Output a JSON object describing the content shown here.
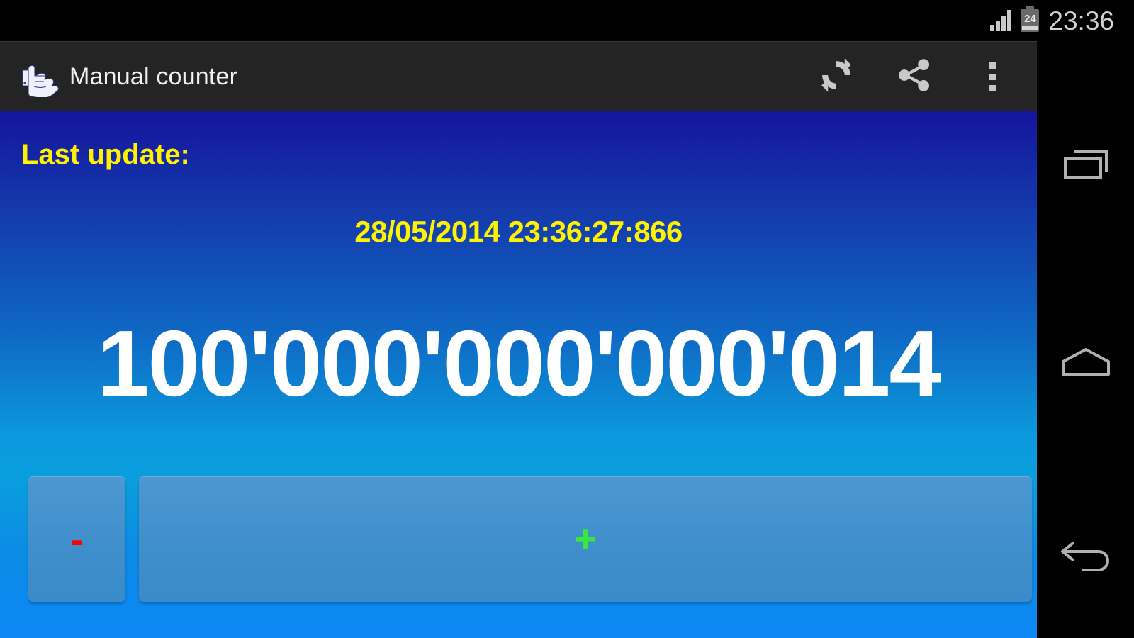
{
  "status_bar": {
    "clock": "23:36",
    "battery_level": "24",
    "signal_icon": "signal-bars-icon",
    "battery_icon": "battery-icon"
  },
  "action_bar": {
    "app_icon": "hand-counting-icon",
    "title": "Manual counter",
    "actions": [
      {
        "name": "refresh-action",
        "icon": "refresh-icon"
      },
      {
        "name": "share-action",
        "icon": "share-icon"
      },
      {
        "name": "overflow-action",
        "icon": "overflow-menu-icon"
      }
    ]
  },
  "main": {
    "last_update_label": "Last update:",
    "last_update_value": "28/05/2014 23:36:27:866",
    "counter_value": "100'000'000'000'014",
    "decrement_label": "-",
    "increment_label": "+"
  },
  "nav_bar": {
    "recents_icon": "recents-icon",
    "home_icon": "home-icon",
    "back_icon": "back-icon"
  },
  "colors": {
    "accent_yellow": "#FFF200",
    "counter_white": "#FFFFFF",
    "minus_red": "#FF0000",
    "plus_green": "#3AE83A",
    "bg_top": "#15159D",
    "bg_bottom": "#0D88F5",
    "action_bar": "#242424",
    "button_face": "#3F8FCC"
  }
}
